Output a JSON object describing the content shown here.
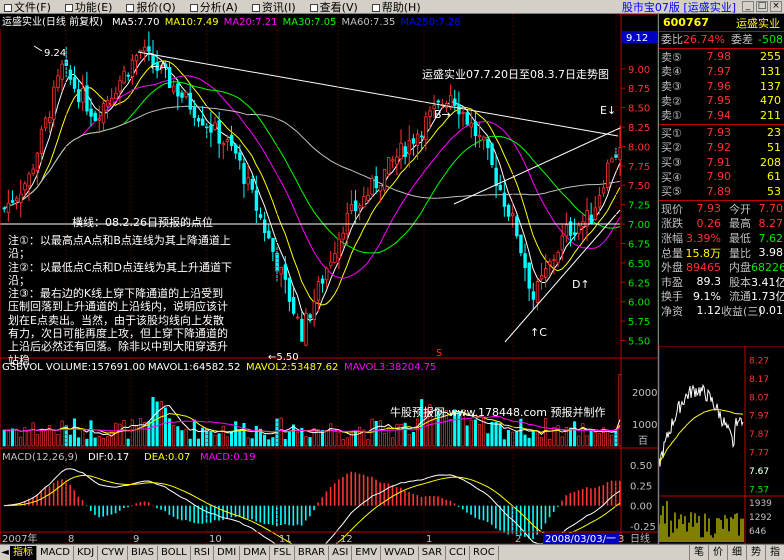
{
  "menu": [
    {
      "label": "文件(F)"
    },
    {
      "label": "功能(E)"
    },
    {
      "label": "报价(Q)"
    },
    {
      "label": "分析(A)"
    },
    {
      "label": "资讯(I)"
    },
    {
      "label": "查看(V)"
    },
    {
      "label": "帮助(H)"
    }
  ],
  "window_title": "股市宝07版 [运盛实业]",
  "title_bar_full": "运盛实业(日线 前复权)",
  "ma_legend": [
    {
      "text": "MA5:7.70",
      "color": "#ffffff"
    },
    {
      "text": "MA10:7.49",
      "color": "#ffff00"
    },
    {
      "text": "MA20:7.21",
      "color": "#ff00ff"
    },
    {
      "text": "MA30:7.05",
      "color": "#00ff00"
    },
    {
      "text": "MA60:7.35",
      "color": "#c0c0c0"
    },
    {
      "text": "MA250:7.28",
      "color": "#0000ff"
    }
  ],
  "annotations": {
    "title_note": "运盛实业07.7.20日至08.3.7日走势图",
    "label_high": "9.24",
    "label_low": "5.50",
    "point_a": "A",
    "point_b": "B",
    "point_c": "C",
    "point_d": "D",
    "point_e": "E",
    "horizontal_line_label": "横线：08.2.26日预报的点位",
    "note_lines": [
      "注①：以最高点A点和B点连线为其上降通道上沿；",
      "注②：以最低点C点和D点连线为其上升通道下沿；",
      "注③：最右边的K线上穿下降通道的上沿受到压制回落到上升通道的上沿线内，说明应该计划在E点卖出。当然，由于该股均线向上发散有力，次日可能再度上攻，但上穿下降通道的上沿后必然还有回落。除非以中到大阳穿透升站稳"
    ],
    "vol_watermark": "牛股预报网 www.178448.com 预报并制作",
    "sep_mark": "S",
    "crosshair_value": "9.12",
    "date_cursor": "2008/03/03/一",
    "x_label_start": "2007年",
    "x_label_end": "日线"
  },
  "price_axis": {
    "labels": [
      "9.00",
      "8.75",
      "8.50",
      "8.25",
      "8.00",
      "7.75",
      "7.50",
      "7.25",
      "7.00",
      "6.75",
      "6.50",
      "6.25",
      "6.00",
      "5.75",
      "5.50"
    ]
  },
  "x_axis": {
    "labels": [
      "8",
      "9",
      "10",
      "11",
      "12",
      "1",
      "2",
      "3"
    ]
  },
  "volume": {
    "legend": [
      {
        "text": "GSBVOL VOLUME:157691.00",
        "color": "#ffffff"
      },
      {
        "text": "MAVOL1:64582.52",
        "color": "#ffffff"
      },
      {
        "text": "MAVOL2:53487.62",
        "color": "#ffff00"
      },
      {
        "text": "MAVOL3:38204.75",
        "color": "#ff00ff"
      }
    ],
    "axis_labels": [
      "2000",
      "1000"
    ],
    "axis_unit": "百"
  },
  "macd": {
    "legend": [
      {
        "text": "MACD(12,26,9)",
        "color": "#c0c0c0"
      },
      {
        "text": "DIF:0.17",
        "color": "#ffffff"
      },
      {
        "text": "DEA:0.07",
        "color": "#ffff00"
      },
      {
        "text": "MACD:0.19",
        "color": "#ff00ff"
      }
    ],
    "axis_labels": [
      "0.50",
      "0.25",
      "0.00",
      "-0.25"
    ]
  },
  "quote": {
    "code": "600767",
    "name": "运盛实业",
    "weibi_label": "委比",
    "weibi_value": "26.74%",
    "weicha_label": "委差",
    "weicha_value": "-508",
    "asks": [
      {
        "label": "卖⑤",
        "price": "7.98",
        "vol": "255"
      },
      {
        "label": "卖④",
        "price": "7.97",
        "vol": "131"
      },
      {
        "label": "卖③",
        "price": "7.96",
        "vol": "137"
      },
      {
        "label": "卖②",
        "price": "7.95",
        "vol": "470"
      },
      {
        "label": "卖①",
        "price": "7.94",
        "vol": "211"
      }
    ],
    "bids": [
      {
        "label": "买①",
        "price": "7.93",
        "vol": "23"
      },
      {
        "label": "买②",
        "price": "7.92",
        "vol": "51"
      },
      {
        "label": "买③",
        "price": "7.91",
        "vol": "208"
      },
      {
        "label": "买④",
        "price": "7.90",
        "vol": "61"
      },
      {
        "label": "买⑤",
        "price": "7.89",
        "vol": "53"
      }
    ],
    "stats": [
      [
        {
          "k": "现价",
          "v": "7.93",
          "vc": "red"
        },
        {
          "k": "今开",
          "v": "7.70",
          "vc": "red"
        }
      ],
      [
        {
          "k": "涨跌",
          "v": "0.26",
          "vc": "red"
        },
        {
          "k": "最高",
          "v": "8.27",
          "vc": "red"
        }
      ],
      [
        {
          "k": "涨幅",
          "v": "3.39%",
          "vc": "red"
        },
        {
          "k": "最低",
          "v": "7.62",
          "vc": "green"
        }
      ],
      [
        {
          "k": "总量",
          "v": "15.8万",
          "vc": "yel"
        },
        {
          "k": "量比",
          "v": "3.98",
          "vc": "wht"
        }
      ],
      [
        {
          "k": "外盘",
          "v": "89465",
          "vc": "red"
        },
        {
          "k": "内盘",
          "v": "68226",
          "vc": "green"
        }
      ],
      [
        {
          "k": "市盈",
          "v": "89.3",
          "vc": "wht"
        },
        {
          "k": "股本",
          "v": "3.41亿",
          "vc": "wht"
        }
      ],
      [
        {
          "k": "换手",
          "v": "9.1%",
          "vc": "wht"
        },
        {
          "k": "流通",
          "v": "1.73亿",
          "vc": "wht"
        }
      ],
      [
        {
          "k": "净资",
          "v": "1.12",
          "vc": "wht"
        },
        {
          "k": "收益(三)",
          "v": "0.01",
          "vc": "wht"
        }
      ]
    ]
  },
  "mini_chart": {
    "price_labels": [
      "8.27",
      "8.17",
      "8.07",
      "7.97",
      "7.87",
      "7.77",
      "7.67",
      "7.57"
    ],
    "volume_labels": [
      "1939",
      "1292",
      "646"
    ],
    "last_price": "7.67"
  },
  "bottom_tabs": [
    {
      "label": "指标",
      "active": true
    },
    {
      "label": "MACD"
    },
    {
      "label": "KDJ"
    },
    {
      "label": "CYW"
    },
    {
      "label": "BIAS"
    },
    {
      "label": "BOLL"
    },
    {
      "label": "RSI"
    },
    {
      "label": "DMI"
    },
    {
      "label": "DMA"
    },
    {
      "label": "FSL"
    },
    {
      "label": "BRAR"
    },
    {
      "label": "ASI"
    },
    {
      "label": "EMV"
    },
    {
      "label": "WVAD"
    },
    {
      "label": "SAR"
    },
    {
      "label": "CCI"
    },
    {
      "label": "ROC"
    }
  ],
  "bottom_right_tabs": [
    "笔",
    "价",
    "细",
    "势",
    "指"
  ],
  "colors": {
    "up": "#ff3232",
    "down": "#00ffff",
    "axis": "#c00000",
    "grid": "#800000"
  }
}
